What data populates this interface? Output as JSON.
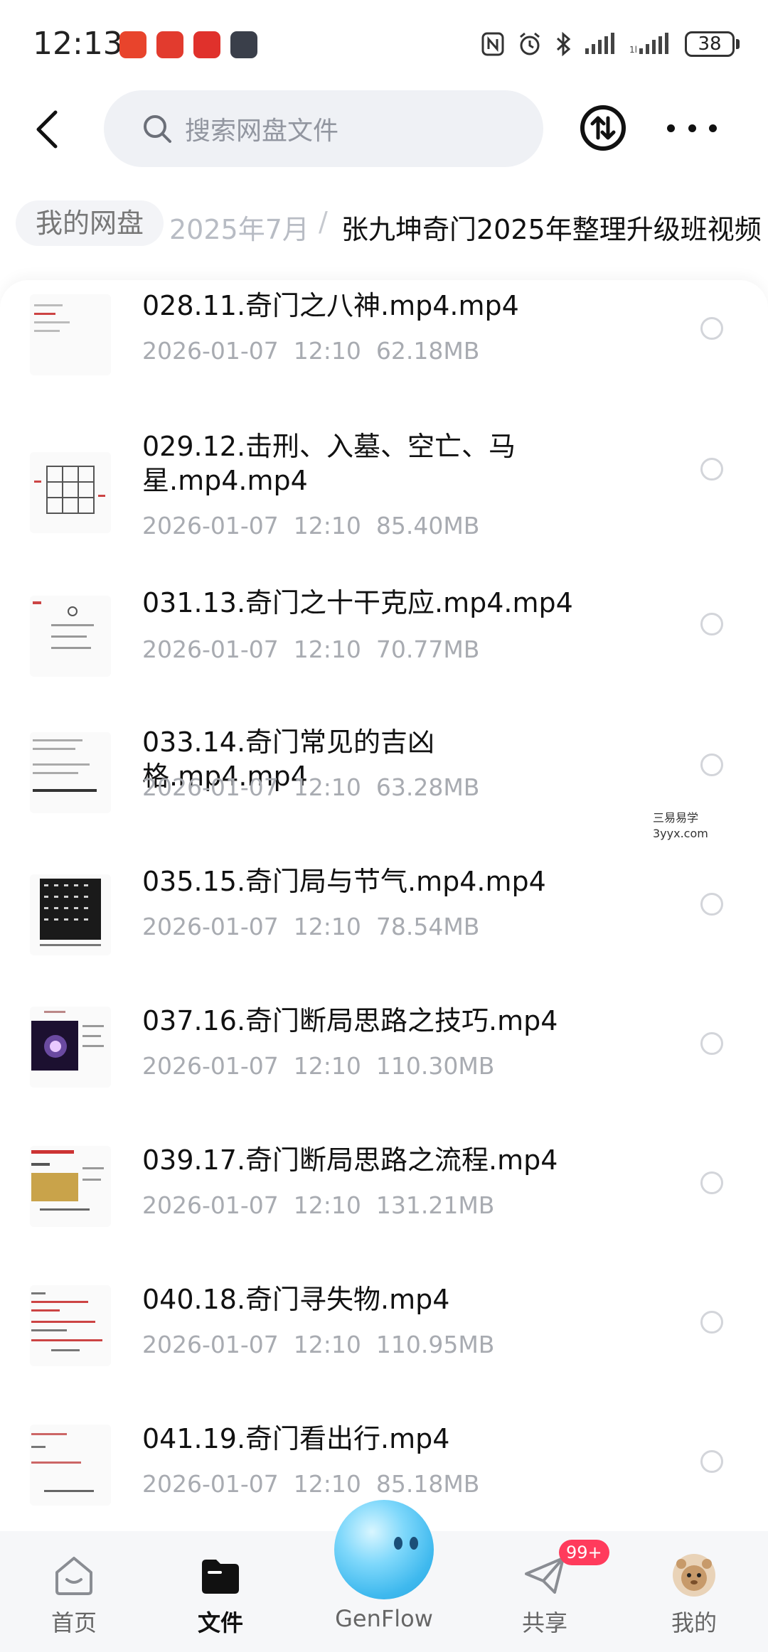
{
  "status_bar": {
    "time": "12:13",
    "battery": "38"
  },
  "header": {
    "search_placeholder": "搜索网盘文件"
  },
  "breadcrumb": {
    "root": "我的网盘",
    "middle": "2025年7月",
    "separator": "/",
    "current": "张九坤奇门2025年整理升级班视频"
  },
  "files": [
    {
      "name": "028.11.奇门之八神.mp4.mp4",
      "date": "2026-01-07",
      "time": "12:10",
      "size": "62.18MB"
    },
    {
      "name": "029.12.击刑、入墓、空亡、马星.mp4.mp4",
      "date": "2026-01-07",
      "time": "12:10",
      "size": "85.40MB"
    },
    {
      "name": "031.13.奇门之十干克应.mp4.mp4",
      "date": "2026-01-07",
      "time": "12:10",
      "size": "70.77MB"
    },
    {
      "name": "033.14.奇门常见的吉凶格.mp4.mp4",
      "date": "2026-01-07",
      "time": "12:10",
      "size": "63.28MB"
    },
    {
      "name": "035.15.奇门局与节气.mp4.mp4",
      "date": "2026-01-07",
      "time": "12:10",
      "size": "78.54MB"
    },
    {
      "name": "037.16.奇门断局思路之技巧.mp4",
      "date": "2026-01-07",
      "time": "12:10",
      "size": "110.30MB"
    },
    {
      "name": "039.17.奇门断局思路之流程.mp4",
      "date": "2026-01-07",
      "time": "12:10",
      "size": "131.21MB"
    },
    {
      "name": "040.18.奇门寻失物.mp4",
      "date": "2026-01-07",
      "time": "12:10",
      "size": "110.95MB"
    },
    {
      "name": "041.19.奇门看出行.mp4",
      "date": "2026-01-07",
      "time": "12:10",
      "size": "85.18MB"
    }
  ],
  "watermark": {
    "line1": "三易易学",
    "line2": "3yyx.com"
  },
  "bottom_nav": {
    "home": "首页",
    "files": "文件",
    "genflow": "GenFlow",
    "share": "共享",
    "share_badge": "99+",
    "me": "我的"
  },
  "colors": {
    "accent_badge": "#ff3b5c",
    "meta_text": "#a8abb1",
    "search_bg": "#eff1f5"
  }
}
